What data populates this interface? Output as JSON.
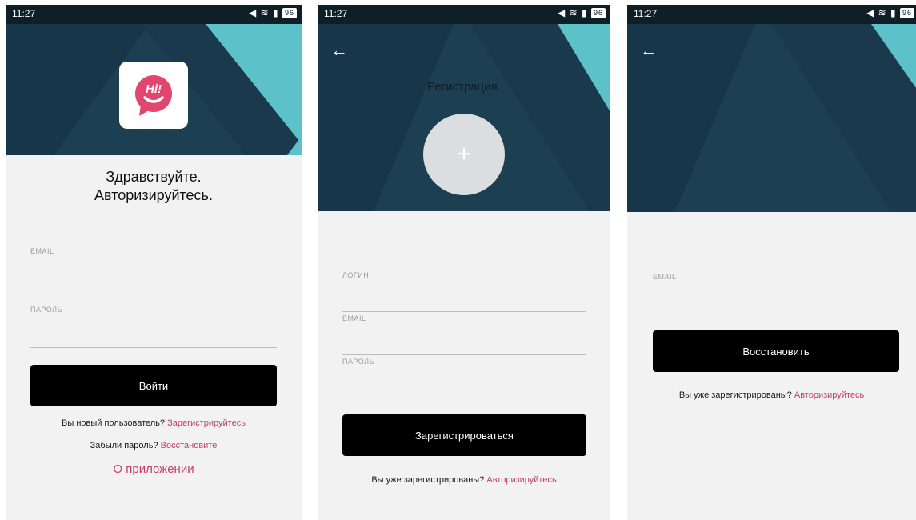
{
  "status": {
    "time": "11:27",
    "battery": "96"
  },
  "login": {
    "greeting_line1": "Здравствуйте.",
    "greeting_line2": "Авторизируйтесь.",
    "email_label": "EMAIL",
    "password_label": "ПАРОЛЬ",
    "login_button": "Войти",
    "new_user_text": "Вы новый пользователь?",
    "register_link": "Зарегистрируйтесь",
    "forgot_text": "Забыли пароль?",
    "restore_link": "Восстановите",
    "about_link": "О приложении"
  },
  "register": {
    "title": "Регистрация.",
    "login_label": "ЛОГИН",
    "email_label": "EMAIL",
    "password_label": "ПАРОЛЬ",
    "register_button": "Зарегистрироваться",
    "already_text": "Вы уже зарегистрированы?",
    "auth_link": "Авторизируйтесь"
  },
  "restore": {
    "email_label": "EMAIL",
    "restore_button": "Восстановить",
    "already_text": "Вы уже зарегистрированы?",
    "auth_link": "Авторизируйтесь"
  },
  "colors": {
    "accent": "#c2416b",
    "header_dark": "#1b3e51",
    "header_teal": "#5cc1c9",
    "button": "#000000"
  },
  "logo": {
    "text": "Hi!"
  }
}
